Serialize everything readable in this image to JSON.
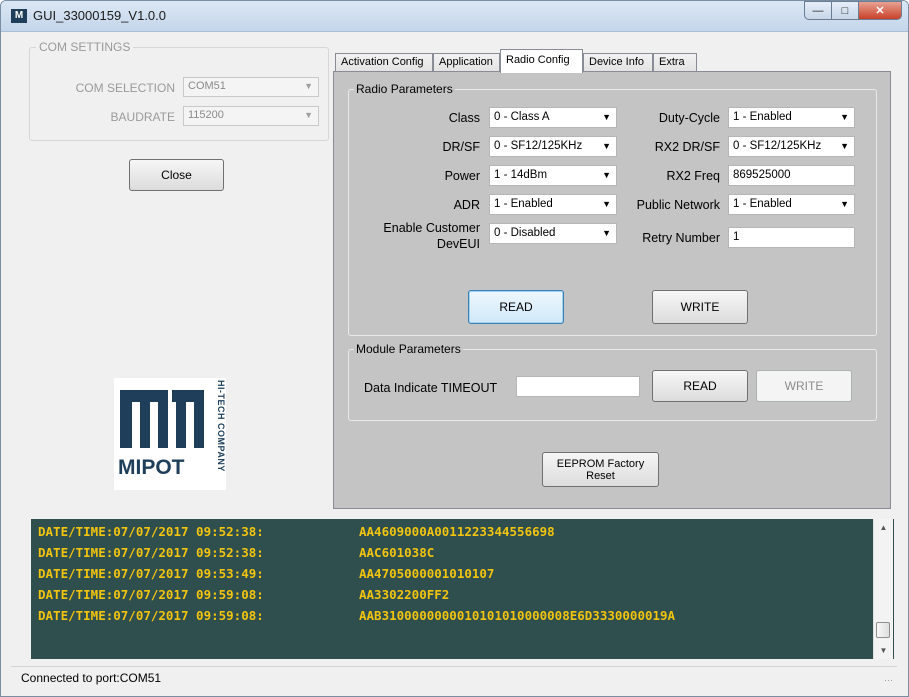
{
  "window": {
    "title": "GUI_33000159_V1.0.0",
    "icon_text": "M",
    "controls": [
      "minimize",
      "maximize",
      "close"
    ]
  },
  "com_settings": {
    "legend": "COM SETTINGS",
    "com_selection_label": "COM SELECTION",
    "com_selection_value": "COM51",
    "baudrate_label": "BAUDRATE",
    "baudrate_value": "115200",
    "close_button": "Close"
  },
  "logo": {
    "name": "MIPOT",
    "tagline": "HI-TECH COMPANY",
    "color": "#1e3e5a"
  },
  "tabs": [
    {
      "label": "Activation Config"
    },
    {
      "label": "Application"
    },
    {
      "label": "Radio Config",
      "active": true
    },
    {
      "label": "Device Info"
    },
    {
      "label": "Extra"
    }
  ],
  "radio_parameters": {
    "legend": "Radio Parameters",
    "class_label": "Class",
    "class_value": "0 - Class A",
    "drsf_label": "DR/SF",
    "drsf_value": "0 - SF12/125KHz",
    "power_label": "Power",
    "power_value": "1 - 14dBm",
    "adr_label": "ADR",
    "adr_value": "1 - Enabled",
    "enable_custom_label_1": "Enable Customer",
    "enable_custom_label_2": "DevEUI",
    "enable_custom_value": "0 - Disabled",
    "duty_cycle_label": "Duty-Cycle",
    "duty_cycle_value": "1 - Enabled",
    "rx2_drsf_label": "RX2 DR/SF",
    "rx2_drsf_value": "0 - SF12/125KHz",
    "rx2_freq_label": "RX2 Freq",
    "rx2_freq_value": "869525000",
    "public_network_label": "Public Network",
    "public_network_value": "1 - Enabled",
    "retry_number_label": "Retry Number",
    "retry_number_value": "1",
    "read_button": "READ",
    "write_button": "WRITE"
  },
  "module_parameters": {
    "legend": "Module Parameters",
    "timeout_label": "Data Indicate TIMEOUT",
    "timeout_value": "",
    "read_button": "READ",
    "write_button": "WRITE"
  },
  "eeprom_button_line1": "EEPROM Factory",
  "eeprom_button_line2": "Reset",
  "log": [
    {
      "time": "DATE/TIME:07/07/2017 09:52:38:",
      "msg": "AA4609000A0011223344556698"
    },
    {
      "time": "DATE/TIME:07/07/2017 09:52:38:",
      "msg": "AAC601038C"
    },
    {
      "time": "DATE/TIME:07/07/2017 09:53:49:",
      "msg": "AA4705000001010107"
    },
    {
      "time": "DATE/TIME:07/07/2017 09:59:08:",
      "msg": "AA3302200FF2"
    },
    {
      "time": "DATE/TIME:07/07/2017 09:59:08:",
      "msg": "AAB3100000000010101010000008E6D3330000019A"
    }
  ],
  "log_colors": {
    "background": "#2f4e4e",
    "text": "#f1c40f"
  },
  "status": "Connected to port:COM51"
}
